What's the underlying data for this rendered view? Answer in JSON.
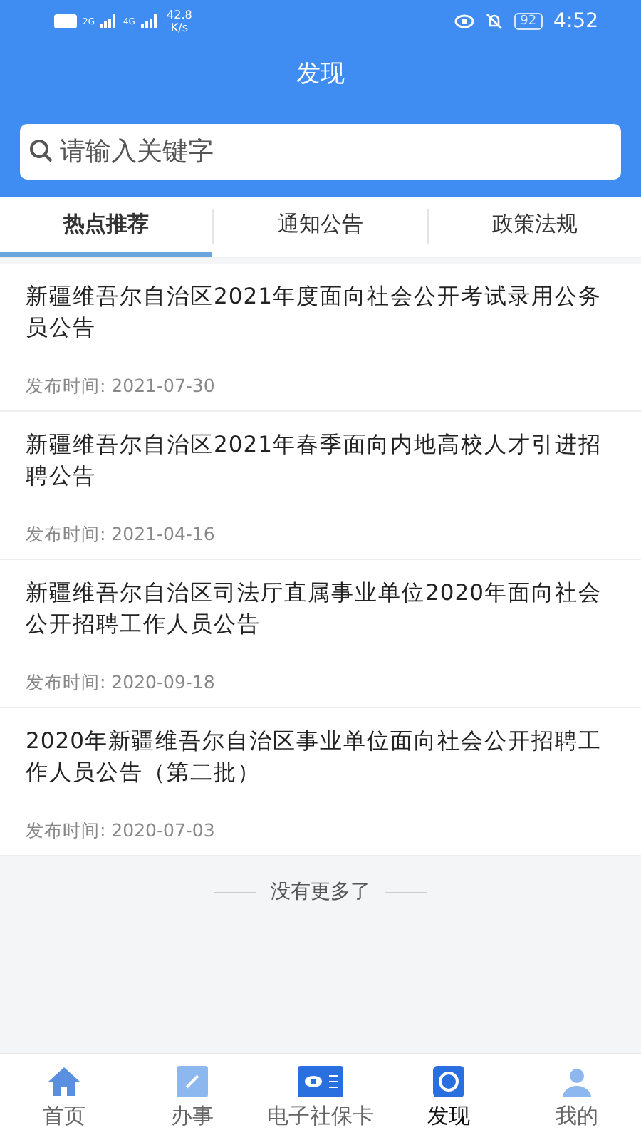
{
  "status_bar": {
    "signal_1": "2G",
    "signal_2": "4G",
    "speed": "42.8 K/s",
    "battery": "92",
    "time": "4:52"
  },
  "header": {
    "title": "发现"
  },
  "search": {
    "placeholder": "请输入关键字"
  },
  "tabs": [
    {
      "label": "热点推荐",
      "selected": true
    },
    {
      "label": "通知公告",
      "selected": false
    },
    {
      "label": "政策法规",
      "selected": false
    }
  ],
  "articles": [
    {
      "title": "新疆维吾尔自治区2021年度面向社会公开考试录用公务员公告",
      "date": "发布时间: 2021-07-30"
    },
    {
      "title": "新疆维吾尔自治区2021年春季面向内地高校人才引进招聘公告",
      "date": "发布时间: 2021-04-16"
    },
    {
      "title": "新疆维吾尔自治区司法厅直属事业单位2020年面向社会公开招聘工作人员公告",
      "date": "发布时间: 2020-09-18"
    },
    {
      "title": "2020年新疆维吾尔自治区事业单位面向社会公开招聘工作人员公告（第二批）",
      "date": "发布时间: 2020-07-03"
    }
  ],
  "end_note": "没有更多了",
  "nav": [
    {
      "label": "首页",
      "kind": "home",
      "selected": false
    },
    {
      "label": "办事",
      "kind": "edit",
      "selected": false
    },
    {
      "label": "电子社保卡",
      "kind": "card",
      "selected": false
    },
    {
      "label": "发现",
      "kind": "discover",
      "selected": true
    },
    {
      "label": "我的",
      "kind": "user",
      "selected": false
    }
  ]
}
